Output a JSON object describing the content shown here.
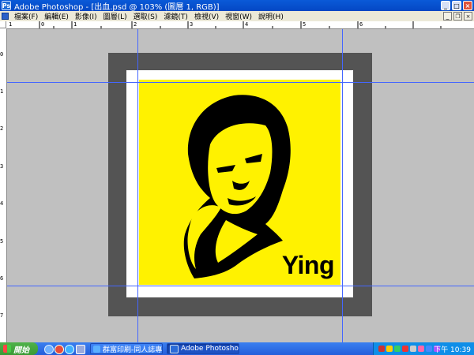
{
  "window": {
    "app_icon": "photoshop-icon",
    "title": "Adobe Photoshop - [出血.psd @ 103% (圖層 1, RGB)]",
    "min_glyph": "_",
    "max_glyph": "□",
    "close_glyph": "×"
  },
  "menubar": {
    "items": [
      "檔案(F)",
      "編輯(E)",
      "影像(I)",
      "圖層(L)",
      "選取(S)",
      "濾鏡(T)",
      "檢視(V)",
      "視窗(W)",
      "說明(H)"
    ],
    "doc_min_glyph": "_",
    "doc_restore_glyph": "❐",
    "doc_close_glyph": "×"
  },
  "rulers": {
    "horizontal_labels": [
      "1",
      "0",
      "1",
      "2",
      "3",
      "4",
      "5",
      "6"
    ],
    "vertical_labels": [
      "0",
      "1",
      "2",
      "3",
      "4",
      "5",
      "6",
      "7"
    ]
  },
  "canvas": {
    "background_color": "#c0c0c0",
    "bleed_frame_color": "#545454",
    "paper_color": "#ffffff",
    "artwork_color": "#fff200",
    "guide_color": "#4466ff",
    "artwork_text": "Ying"
  },
  "taskbar": {
    "start_label": "開始",
    "quick_launch_icons": [
      "browser-icon",
      "media-icon",
      "ie-icon",
      "more-icon"
    ],
    "tasks": [
      {
        "label": "群富印刷-同人誌專...",
        "icon": "ie-icon",
        "active": false
      },
      {
        "label": "Adobe Photoshop - [...",
        "icon": "photoshop-icon",
        "active": true
      }
    ],
    "tray_icons": [
      "network-icon",
      "shield-icon",
      "chat-icon",
      "antivirus-icon",
      "volume-icon",
      "messenger-icon",
      "update-icon",
      "app-icon"
    ],
    "clock": "下午 10:39"
  }
}
